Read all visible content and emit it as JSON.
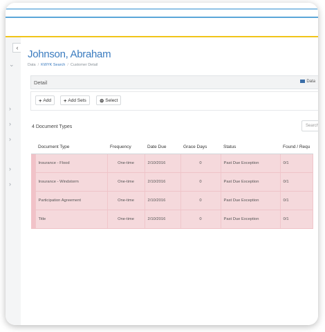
{
  "customer": {
    "name": "Johnson, Abraham"
  },
  "breadcrumb": [
    "Data",
    "KWYK Search",
    "Customer Detail"
  ],
  "panel": {
    "title": "Detail",
    "data_tab": "Data"
  },
  "toolbar": {
    "add_label": "Add",
    "add_sets_label": "Add Sets",
    "select_label": "Select"
  },
  "document_count": "4 Document Types",
  "search_placeholder": "Search",
  "table": {
    "columns": [
      "Document Type",
      "Frequency",
      "Date Due",
      "Grace Days",
      "Status",
      "Found / Requ"
    ],
    "rows": [
      [
        "Insurance - Flood",
        "One-time",
        "2/10/2016",
        "0",
        "Past Due Exception",
        "0/1"
      ],
      [
        "Insurance - Windstorm",
        "One-time",
        "2/10/2016",
        "0",
        "Past Due Exception",
        "0/1"
      ],
      [
        "Participation Agreement",
        "One-time",
        "2/10/2016",
        "0",
        "Past Due Exception",
        "0/1"
      ],
      [
        "Title",
        "One-time",
        "2/10/2016",
        "0",
        "Past Due Exception",
        "0/1"
      ]
    ]
  },
  "colors": {
    "accent_blue": "#3a7bbf",
    "exception_row": "#f5d9dc",
    "header_yellow_line": "#f0c419"
  },
  "icons": {
    "collapse": "chevron-left-icon",
    "sidebar": "chevron-right-icon",
    "add": "plus-icon",
    "select": "circle-check-icon",
    "data_tab": "grid-icon"
  }
}
